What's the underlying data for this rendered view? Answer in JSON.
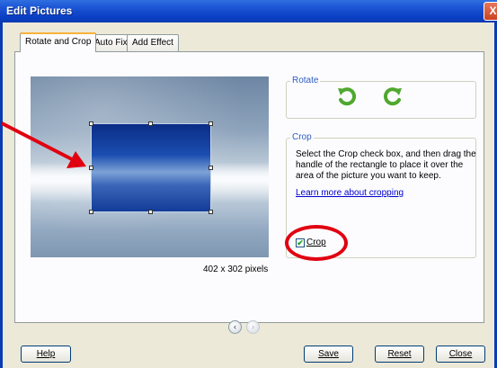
{
  "window": {
    "title": "Edit Pictures",
    "close_glyph": "X"
  },
  "tabs": [
    {
      "label": "Rotate and Crop",
      "active": true
    },
    {
      "label": "Auto Fix",
      "active": false
    },
    {
      "label": "Add Effect",
      "active": false
    }
  ],
  "picture": {
    "dimensions": "402 x 302 pixels"
  },
  "rotate": {
    "title": "Rotate",
    "left_icon": "rotate-left-icon",
    "right_icon": "rotate-right-icon"
  },
  "crop": {
    "title": "Crop",
    "instructions": "Select the Crop check box, and then drag the handle of the rectangle to place it over the area of the picture you want to keep.",
    "learn_more": "Learn more about cropping",
    "checkbox_label": "Crop",
    "checked": true
  },
  "nav": {
    "prev_glyph": "‹",
    "next_glyph": "›"
  },
  "buttons": {
    "help": "Help",
    "save": "Save",
    "reset": "Reset",
    "close": "Close"
  },
  "colors": {
    "titlebar": "#0a3fc4",
    "group_title": "#2e5ec2",
    "annotation": "#e00010",
    "rotate_arrow": "#4fa82e"
  }
}
